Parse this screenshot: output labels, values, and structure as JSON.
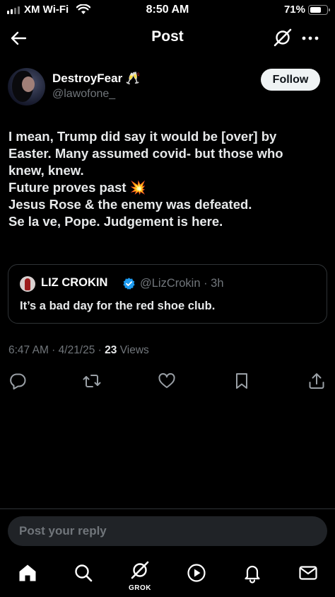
{
  "status_bar": {
    "carrier": "XM Wi-Fi",
    "time": "8:50 AM",
    "battery": "71%",
    "battery_level": 0.71
  },
  "header": {
    "title": "Post",
    "icons": [
      "back-arrow-icon",
      "grok-icon",
      "more-icon"
    ]
  },
  "author": {
    "display_name": "DestroyFear 🥂",
    "handle": "@lawofone_",
    "follow_label": "Follow"
  },
  "post": {
    "lines": [
      "I mean, Trump did say it would be [over] by",
      "Easter. Many assumed covid- but those who",
      "knew, knew.",
      "Future proves past 💥",
      "Jesus Rose & the enemy was defeated.",
      "Se la ve, Pope. Judgement is here."
    ]
  },
  "quote": {
    "name": "LIZ CROKIN",
    "handle": "@LizCrokin · 3h",
    "text": "It’s a bad day for the red shoe club.",
    "verified_color": "#1d9bf0"
  },
  "meta": {
    "time_date": "6:47 AM · 4/21/25 · ",
    "views_count": "23",
    "views_label": " Views"
  },
  "actions": [
    "reply-icon",
    "retweet-icon",
    "like-icon",
    "bookmark-icon",
    "share-icon"
  ],
  "reply": {
    "placeholder": "Post your reply"
  },
  "tabbar": {
    "grok_label": "GROK",
    "items": [
      "home-icon",
      "search-icon",
      "grok-icon",
      "video-icon",
      "notifications-icon",
      "messages-icon"
    ]
  },
  "colors": {
    "background": "#000000",
    "text": "#e7e9ea",
    "secondary": "#71767b",
    "border": "#2f3336",
    "accent": "#1d9bf0"
  }
}
